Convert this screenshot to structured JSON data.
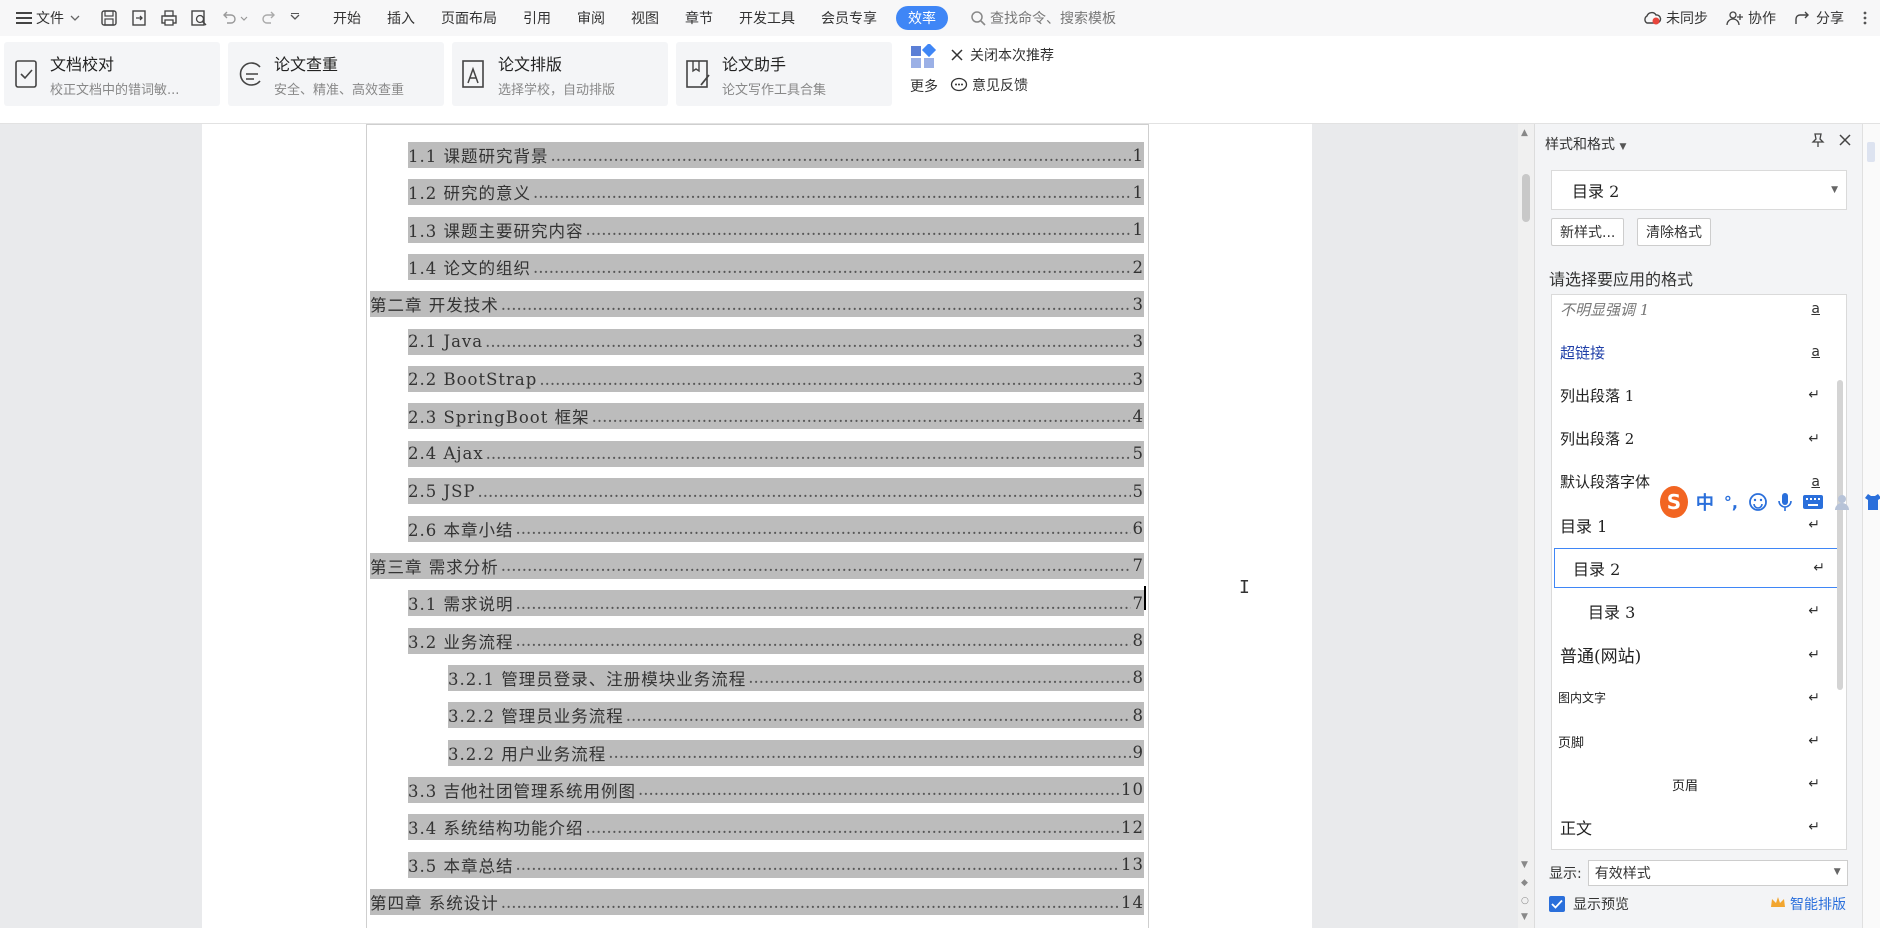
{
  "topbar": {
    "file_label": "文件",
    "tabs": [
      "开始",
      "插入",
      "页面布局",
      "引用",
      "审阅",
      "视图",
      "章节",
      "开发工具",
      "会员专享",
      "效率"
    ],
    "active_tab": "效率",
    "search_placeholder": "查找命令、搜索模板",
    "sync_label": "未同步",
    "collab_label": "协作",
    "share_label": "分享"
  },
  "ribbon": {
    "cards": [
      {
        "title": "文档校对",
        "subtitle": "校正文档中的错词敏..."
      },
      {
        "title": "论文查重",
        "subtitle": "安全、精准、高效查重"
      },
      {
        "title": "论文排版",
        "subtitle": "选择学校，自动排版"
      },
      {
        "title": "论文助手",
        "subtitle": "论文写作工具合集"
      }
    ],
    "more_label": "更多",
    "close_recommend_label": "关闭本次推荐",
    "feedback_label": "意见反馈"
  },
  "toc": [
    {
      "title": "1.1  课题研究背景",
      "page": "1",
      "level": 2
    },
    {
      "title": "1.2  研究的意义",
      "page": "1",
      "level": 2
    },
    {
      "title": "1.3  课题主要研究内容",
      "page": "1",
      "level": 2
    },
    {
      "title": "1.4  论文的组织",
      "page": "2",
      "level": 2
    },
    {
      "title": "第二章  开发技术",
      "page": "3",
      "level": 1
    },
    {
      "title": "2.1 Java",
      "page": "3",
      "level": 2
    },
    {
      "title": "2.2 BootStrap",
      "page": "3",
      "level": 2
    },
    {
      "title": "2.3 SpringBoot 框架",
      "page": "4",
      "level": 2
    },
    {
      "title": "2.4 Ajax",
      "page": "5",
      "level": 2
    },
    {
      "title": "2.5 JSP",
      "page": "5",
      "level": 2
    },
    {
      "title": "2.6  本章小结",
      "page": "6",
      "level": 2
    },
    {
      "title": "第三章  需求分析",
      "page": "7",
      "level": 1
    },
    {
      "title": "3.1  需求说明",
      "page": "7",
      "level": 2
    },
    {
      "title": "3.2  业务流程",
      "page": "8",
      "level": 2
    },
    {
      "title": "3.2.1 管理员登录、注册模块业务流程",
      "page": "8",
      "level": 3
    },
    {
      "title": "3.2.2 管理员业务流程",
      "page": "8",
      "level": 3
    },
    {
      "title": "3.2.2 用户业务流程",
      "page": "9",
      "level": 3
    },
    {
      "title": "3.3  吉他社团管理系统用例图",
      "page": "10",
      "level": 2
    },
    {
      "title": "3.4  系统结构功能介绍",
      "page": "12",
      "level": 2
    },
    {
      "title": "3.5  本章总结",
      "page": "13",
      "level": 2
    },
    {
      "title": "第四章  系统设计",
      "page": "14",
      "level": 1
    }
  ],
  "pane": {
    "title": "样式和格式",
    "current_style": "目录 2",
    "new_style_label": "新样式...",
    "clear_format_label": "清除格式",
    "choose_label": "请选择要应用的格式",
    "styles": [
      {
        "name": "不明显强调 1",
        "mark": "a",
        "kind": "char"
      },
      {
        "name": "超链接",
        "mark": "a",
        "kind": "char"
      },
      {
        "name": "列出段落 1",
        "mark": "↵",
        "kind": "para"
      },
      {
        "name": "列出段落 2",
        "mark": "↵",
        "kind": "para"
      },
      {
        "name": "默认段落字体",
        "mark": "a",
        "kind": "char"
      },
      {
        "name": "目录  1",
        "mark": "↵",
        "kind": "para"
      },
      {
        "name": "目录  2",
        "mark": "↵",
        "kind": "para"
      },
      {
        "name": "目录  3",
        "mark": "↵",
        "kind": "para"
      },
      {
        "name": "普通(网站)",
        "mark": "↵",
        "kind": "para"
      },
      {
        "name": "图内文字",
        "mark": "↵",
        "kind": "para"
      },
      {
        "name": "页脚",
        "mark": "↵",
        "kind": "para"
      },
      {
        "name": "页眉",
        "mark": "↵",
        "kind": "para"
      },
      {
        "name": "正文",
        "mark": "↵",
        "kind": "para"
      }
    ],
    "selected_style": "目录  2",
    "show_label": "显示:",
    "show_value": "有效样式",
    "preview_label": "显示预览",
    "smart_layout_label": "智能排版"
  },
  "ime": {
    "mode_label": "中",
    "punct_label": "°,"
  },
  "colors": {
    "accent": "#3f86f6",
    "toc_highlight": "#bcbcbc",
    "link": "#1f3fa8"
  }
}
